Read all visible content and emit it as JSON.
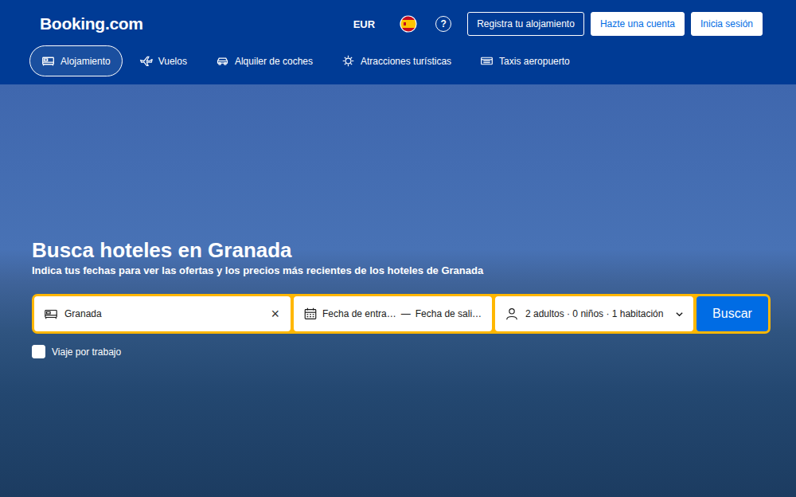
{
  "header": {
    "logo": "Booking.com",
    "currency": "EUR",
    "help": "?",
    "buttons": [
      {
        "label": "Registra tu alojamiento",
        "kind": "outline"
      },
      {
        "label": "Hazte una cuenta",
        "kind": "solid"
      },
      {
        "label": "Inicia sesión",
        "kind": "solid"
      }
    ]
  },
  "nav": [
    {
      "label": "Alojamiento",
      "selected": true
    },
    {
      "label": "Vuelos",
      "selected": false
    },
    {
      "label": "Alquiler de coches",
      "selected": false
    },
    {
      "label": "Atracciones turísticas",
      "selected": false
    },
    {
      "label": "Taxis aeropuerto",
      "selected": false
    }
  ],
  "hero": {
    "title": "Busca hoteles en Granada",
    "subtitle": "Indica tus fechas para ver las ofertas y los precios más recientes de los hoteles de Granada"
  },
  "search": {
    "destination": "Granada",
    "clear": "×",
    "checkin": "Fecha de entra…",
    "separator": "—",
    "checkout": "Fecha de sali…",
    "guests": "2 adultos · 0 niños · 1 habitación",
    "button": "Buscar"
  },
  "business_trip": {
    "label": "Viaje por trabajo",
    "checked": false
  }
}
